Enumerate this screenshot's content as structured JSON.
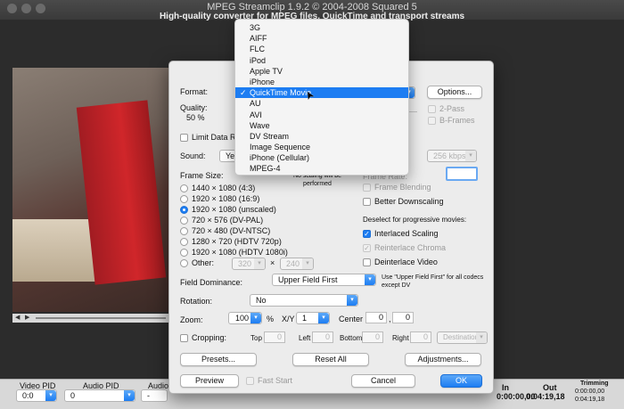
{
  "window": {
    "title": "MPEG Streamclip 1.9.2 © 2004-2008 Squared 5",
    "subtitle": "High-quality converter for MPEG files, QuickTime and transport streams"
  },
  "bottombar": {
    "video_pid_label": "Video PID",
    "video_pid_value": "0:0",
    "audio_pid_label": "Audio PID",
    "audio_pid_value": "0",
    "audio2_label": "Audio",
    "audio2_value": "-",
    "in_label": "In",
    "in_value": "0:00:00,00",
    "out_label": "Out",
    "out_value": "0:04:19,18",
    "trimming_label": "Trimming",
    "trimming_in": "0:00:00,00",
    "trimming_out": "0:04:19,18"
  },
  "dialog": {
    "format_label": "Format:",
    "options_button": "Options...",
    "quality_label": "Quality:",
    "quality_value": "50 %",
    "two_pass": "2-Pass",
    "b_frames": "B-Frames",
    "limit_data_rate": "Limit Data Ra",
    "sound_label": "Sound:",
    "sound_value": "Ye",
    "sound_bitrate": "256 kbps",
    "frame_size_label": "Frame Size:",
    "no_scaling_note": "No scaling will be performed",
    "frame_sizes": [
      {
        "label": "1440 × 1080  (4:3)",
        "selected": false
      },
      {
        "label": "1920 × 1080  (16:9)",
        "selected": false
      },
      {
        "label": "1920 × 1080  (unscaled)",
        "selected": true
      },
      {
        "label": "720 × 576  (DV-PAL)",
        "selected": false
      },
      {
        "label": "720 × 480  (DV-NTSC)",
        "selected": false
      },
      {
        "label": "1280 × 720  (HDTV 720p)",
        "selected": false
      },
      {
        "label": "1920 × 1080  (HDTV 1080i)",
        "selected": false
      }
    ],
    "other_label": "Other:",
    "other_width": "320",
    "other_height": "240",
    "other_x": "×",
    "frame_rate_label": "Frame Rate:",
    "frame_blending": "Frame Blending",
    "better_downscaling": "Better Downscaling",
    "deselect_note": "Deselect for progressive movies:",
    "interlaced_scaling": "Interlaced Scaling",
    "reinterlace_chroma": "Reinterlace Chroma",
    "deinterlace_video": "Deinterlace Video",
    "field_dominance_label": "Field Dominance:",
    "field_dominance_value": "Upper Field First",
    "field_note": "Use \"Upper Field First\" for all codecs except DV",
    "rotation_label": "Rotation:",
    "rotation_value": "No",
    "zoom_label": "Zoom:",
    "zoom_value": "100",
    "zoom_unit": "%",
    "xy_label": "X/Y",
    "xy_value": "1",
    "center_label": "Center",
    "center_x": "0",
    "center_comma": ",",
    "center_y": "0",
    "cropping_label": "Cropping:",
    "top_label": "Top",
    "top_value": "0",
    "left_label": "Left",
    "left_value": "0",
    "bottom_label": "Bottom",
    "bottom_value": "0",
    "right_label": "Right",
    "right_value": "0",
    "destination_value": "Destination",
    "presets_button": "Presets...",
    "reset_all_button": "Reset All",
    "adjustments_button": "Adjustments...",
    "preview_button": "Preview",
    "fast_start": "Fast Start",
    "cancel_button": "Cancel",
    "ok_button": "OK"
  },
  "format_menu": {
    "items": [
      "3G",
      "AIFF",
      "FLC",
      "iPod",
      "Apple TV",
      "iPhone",
      "QuickTime Movie",
      "AU",
      "AVI",
      "Wave",
      "DV Stream",
      "Image Sequence",
      "iPhone (Cellular)",
      "MPEG-4"
    ],
    "selected": "QuickTime Movie",
    "check_glyph": "✓"
  },
  "colors": {
    "accent": "#1d7df2",
    "dialog_bg": "#ececec"
  }
}
